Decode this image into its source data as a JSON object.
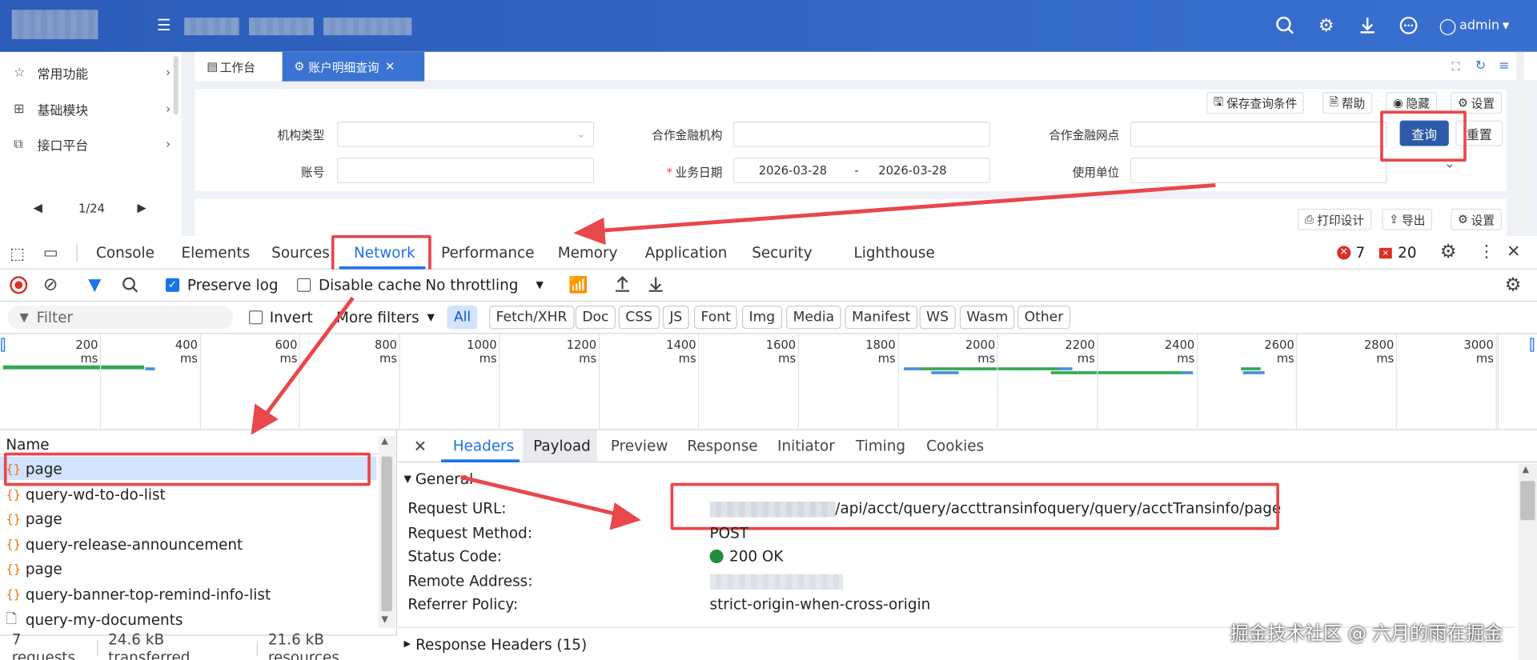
{
  "topbar": {
    "user": "admin"
  },
  "sidebar": {
    "items": [
      {
        "label": "常用功能"
      },
      {
        "label": "基础模块"
      },
      {
        "label": "接口平台"
      }
    ],
    "pager": "1/24"
  },
  "app": {
    "tabs": [
      {
        "label": "工作台"
      },
      {
        "label": "账户明细查询"
      }
    ],
    "toolbar": {
      "save_query": "保存查询条件",
      "help": "帮助",
      "hide": "隐藏",
      "settings": "设置"
    },
    "form": {
      "org_type": "机构类型",
      "partner_fi": "合作金融机构",
      "partner_branch": "合作金融网点",
      "account": "账号",
      "biz_date": "业务日期",
      "required_mark": "*",
      "date_from": "2026-03-28",
      "date_sep": "-",
      "date_to": "2026-03-28",
      "using_unit": "使用单位"
    },
    "query_btn": "查询",
    "reset_btn": "重置",
    "result_toolbar": {
      "print_design": "打印设计",
      "export": "导出",
      "settings": "设置"
    }
  },
  "devtools": {
    "tabs": [
      "Console",
      "Elements",
      "Sources",
      "Network",
      "Performance",
      "Memory",
      "Application",
      "Security",
      "Lighthouse"
    ],
    "active_tab": "Network",
    "errors": "7",
    "warnings": "20",
    "toolbar": {
      "preserve_log": "Preserve log",
      "disable_cache": "Disable cache",
      "throttling": "No throttling"
    },
    "filter": {
      "placeholder": "Filter",
      "invert": "Invert",
      "more_filters": "More filters",
      "chips": [
        "All",
        "Fetch/XHR",
        "Doc",
        "CSS",
        "JS",
        "Font",
        "Img",
        "Media",
        "Manifest",
        "WS",
        "Wasm",
        "Other"
      ]
    },
    "timeline_ticks": [
      "200 ms",
      "400 ms",
      "600 ms",
      "800 ms",
      "1000 ms",
      "1200 ms",
      "1400 ms",
      "1600 ms",
      "1800 ms",
      "2000 ms",
      "2200 ms",
      "2400 ms",
      "2600 ms",
      "2800 ms",
      "3000 ms"
    ],
    "requests": {
      "header": "Name",
      "items": [
        "page",
        "query-wd-to-do-list",
        "page",
        "query-release-announcement",
        "page",
        "query-banner-top-remind-info-list",
        "query-my-documents"
      ]
    },
    "status_bar": {
      "requests": "7 requests",
      "transferred": "24.6 kB transferred",
      "resources": "21.6 kB resources"
    },
    "panel_tabs": [
      "Headers",
      "Payload",
      "Preview",
      "Response",
      "Initiator",
      "Timing",
      "Cookies"
    ],
    "general": {
      "title": "General",
      "rows": [
        {
          "key": "Request URL:",
          "value": "/api/acct/query/accttransinfoquery/query/acctTransinfo/page"
        },
        {
          "key": "Request Method:",
          "value": "POST"
        },
        {
          "key": "Status Code:",
          "value": "200 OK"
        },
        {
          "key": "Remote Address:",
          "value": ""
        },
        {
          "key": "Referrer Policy:",
          "value": "strict-origin-when-cross-origin"
        }
      ]
    },
    "response_headers": "Response Headers (15)"
  },
  "watermark": "掘金技术社区 @ 六月的雨在掘金",
  "colors": {
    "topbar": "#2f64c4",
    "accent_red": "#e8474c",
    "query_btn": "#2d5aa8",
    "devtools_active": "#1a73e8"
  }
}
